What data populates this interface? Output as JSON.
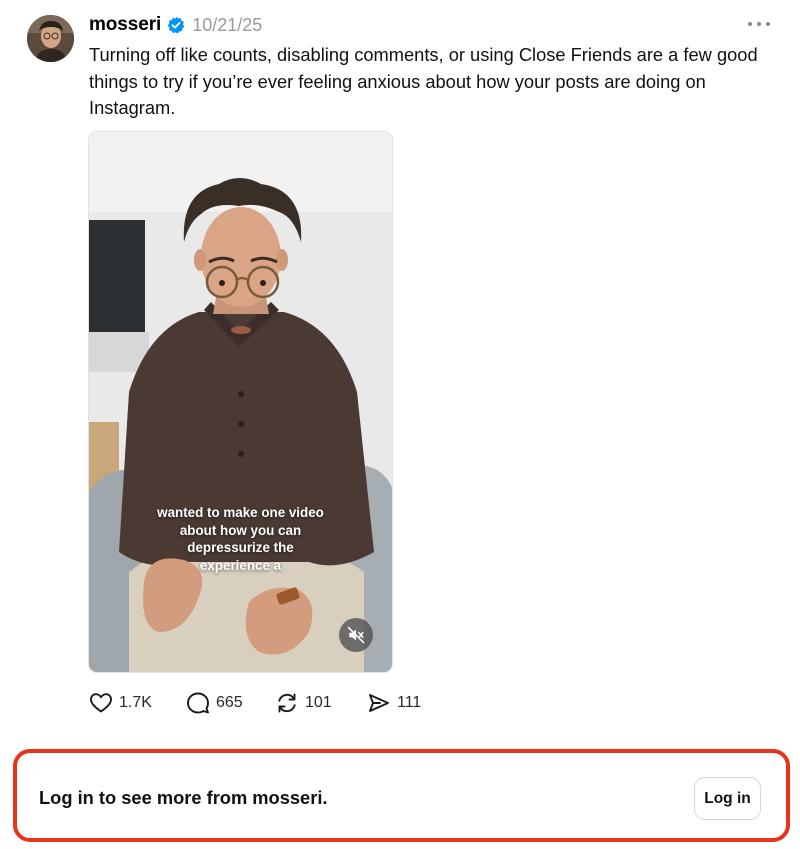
{
  "post": {
    "username": "mosseri",
    "verified": true,
    "timestamp": "10/21/25",
    "text": "Turning off like counts, disabling comments, or using Close Friends are a few good things to try if you’re ever feeling anxious about how your posts are doing on Instagram.",
    "video": {
      "caption_lines": [
        "wanted to make one video",
        "about how you can",
        "depressurize the",
        "experience a"
      ],
      "muted": true
    },
    "actions": {
      "likes": "1.7K",
      "comments": "665",
      "reposts": "101",
      "shares": "111"
    },
    "icons": {
      "more": "more-horizontal-icon",
      "verified": "verified-badge-icon",
      "like": "heart-icon",
      "comment": "comment-bubble-icon",
      "repost": "repost-icon",
      "share": "send-icon",
      "mute": "speaker-muted-icon"
    }
  },
  "login_prompt": {
    "text": "Log in to see more from mosseri.",
    "button_label": "Log in"
  },
  "colors": {
    "verified_blue": "#0095f6",
    "highlight_red": "#e8321b",
    "timestamp_gray": "#9a9a9a"
  }
}
